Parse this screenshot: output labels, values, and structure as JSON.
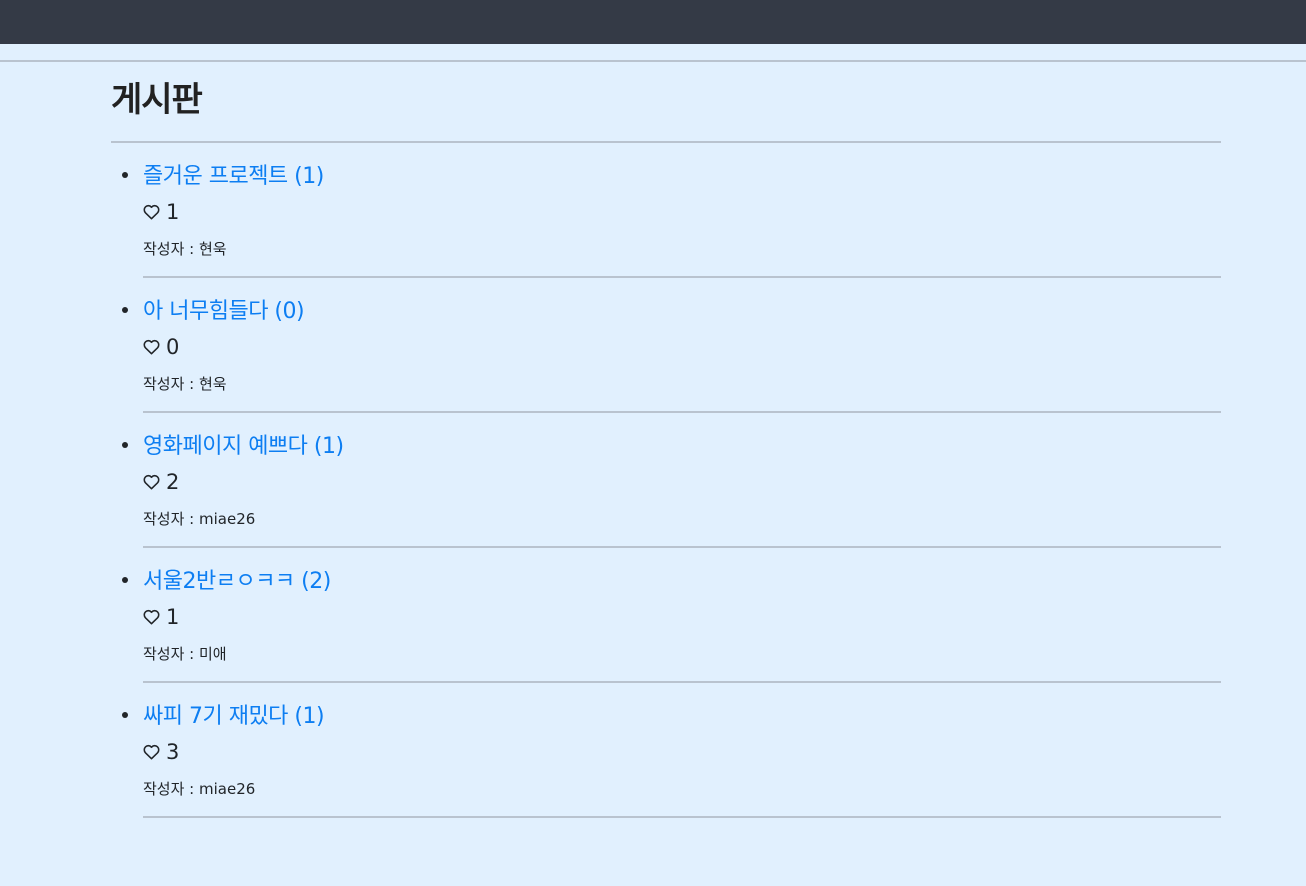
{
  "page": {
    "title": "게시판"
  },
  "posts": [
    {
      "title": "즐거운 프로젝트 (1)",
      "likes": "1",
      "author_label": "작성자 : 현욱"
    },
    {
      "title": "아 너무힘들다 (0)",
      "likes": "0",
      "author_label": "작성자 : 현욱"
    },
    {
      "title": "영화페이지 예쁘다 (1)",
      "likes": "2",
      "author_label": "작성자 : miae26"
    },
    {
      "title": "서울2반ㄹㅇㅋㅋ (2)",
      "likes": "1",
      "author_label": "작성자 : 미애"
    },
    {
      "title": "싸피 7기 재밌다 (1)",
      "likes": "3",
      "author_label": "작성자 : miae26"
    }
  ],
  "icons": {
    "like": "heart-outline-icon"
  },
  "colors": {
    "background": "#e1f0fe",
    "navbar": "#343a46",
    "link": "#0d7ef2",
    "divider": "#b9c3cf"
  }
}
